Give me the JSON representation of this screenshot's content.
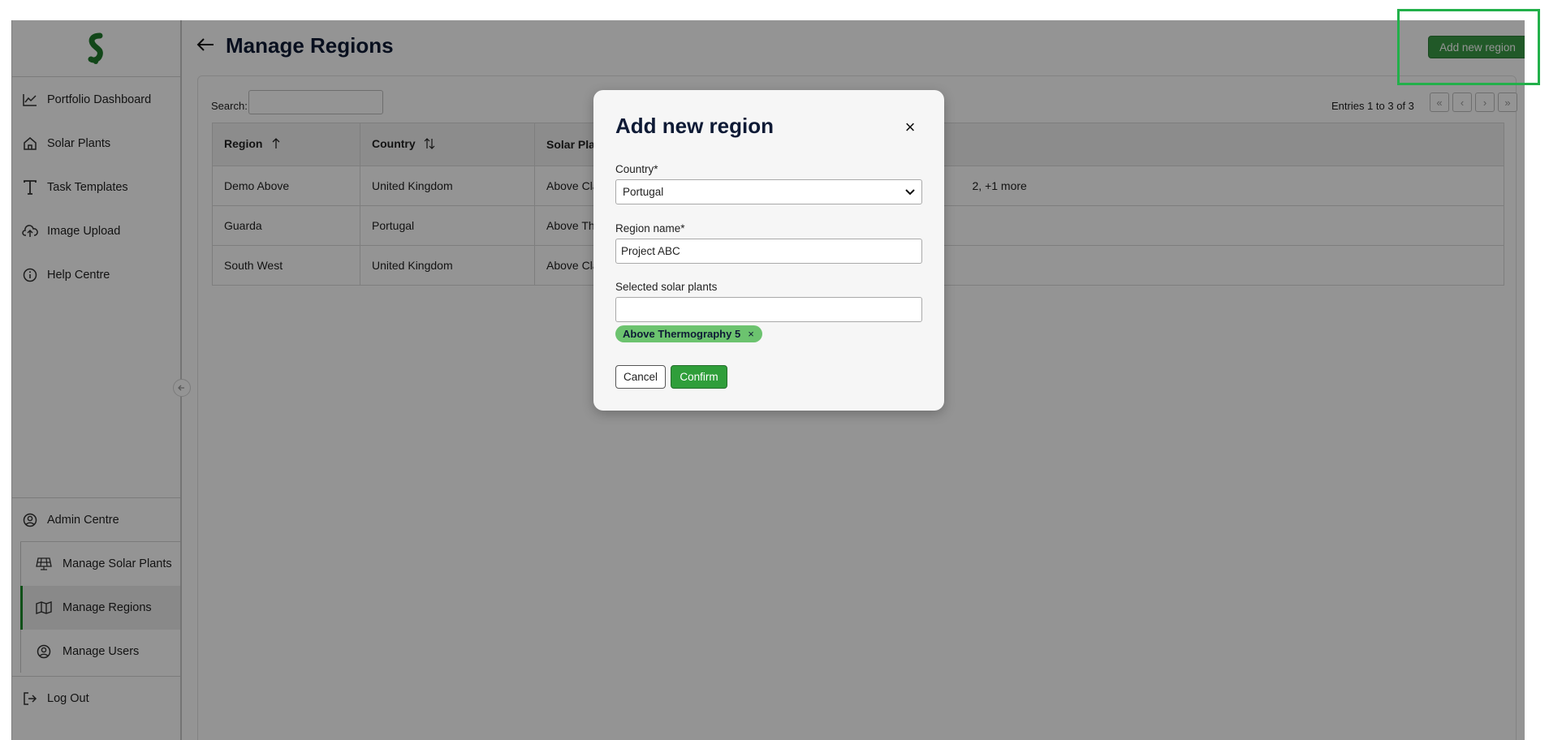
{
  "header": {
    "title": "Manage Regions",
    "add_button_label": "Add new region"
  },
  "sidebar": {
    "items": [
      {
        "label": "Portfolio Dashboard",
        "icon": "chart-line-icon"
      },
      {
        "label": "Solar Plants",
        "icon": "home-icon"
      },
      {
        "label": "Task Templates",
        "icon": "template-t-icon"
      },
      {
        "label": "Image Upload",
        "icon": "cloud-upload-icon"
      },
      {
        "label": "Help Centre",
        "icon": "info-icon"
      }
    ],
    "admin": {
      "label": "Admin Centre",
      "subitems": [
        {
          "label": "Manage Solar Plants",
          "icon": "solar-panel-icon"
        },
        {
          "label": "Manage Regions",
          "icon": "map-icon",
          "active": true
        },
        {
          "label": "Manage Users",
          "icon": "user-circle-icon"
        }
      ]
    },
    "logout_label": "Log Out"
  },
  "table_controls": {
    "search_label": "Search:",
    "entries_text": "Entries 1 to 3 of 3",
    "pagination": [
      "«",
      "‹",
      "›",
      "»"
    ]
  },
  "table": {
    "columns": [
      "Region",
      "Country",
      "Solar Plan"
    ],
    "rows": [
      {
        "region": "Demo Above",
        "country": "United Kingdom",
        "plants": "Above Cla",
        "tail": "2, +1 more"
      },
      {
        "region": "Guarda",
        "country": "Portugal",
        "plants": "Above Th",
        "tail": ""
      },
      {
        "region": "South West",
        "country": "United Kingdom",
        "plants": "Above Cla",
        "tail": ""
      }
    ]
  },
  "modal": {
    "title": "Add new region",
    "close_symbol": "×",
    "country_label": "Country*",
    "country_value": "Portugal",
    "region_label": "Region name*",
    "region_value": "Project ABC",
    "plants_label": "Selected solar plants",
    "plants_value": "",
    "selected_chip": "Above Thermography 5",
    "chip_remove": "×",
    "cancel_label": "Cancel",
    "confirm_label": "Confirm"
  },
  "colors": {
    "brand_green": "#2f9e3a",
    "chip_green": "#6cc36f",
    "highlight": "#22b04a"
  }
}
